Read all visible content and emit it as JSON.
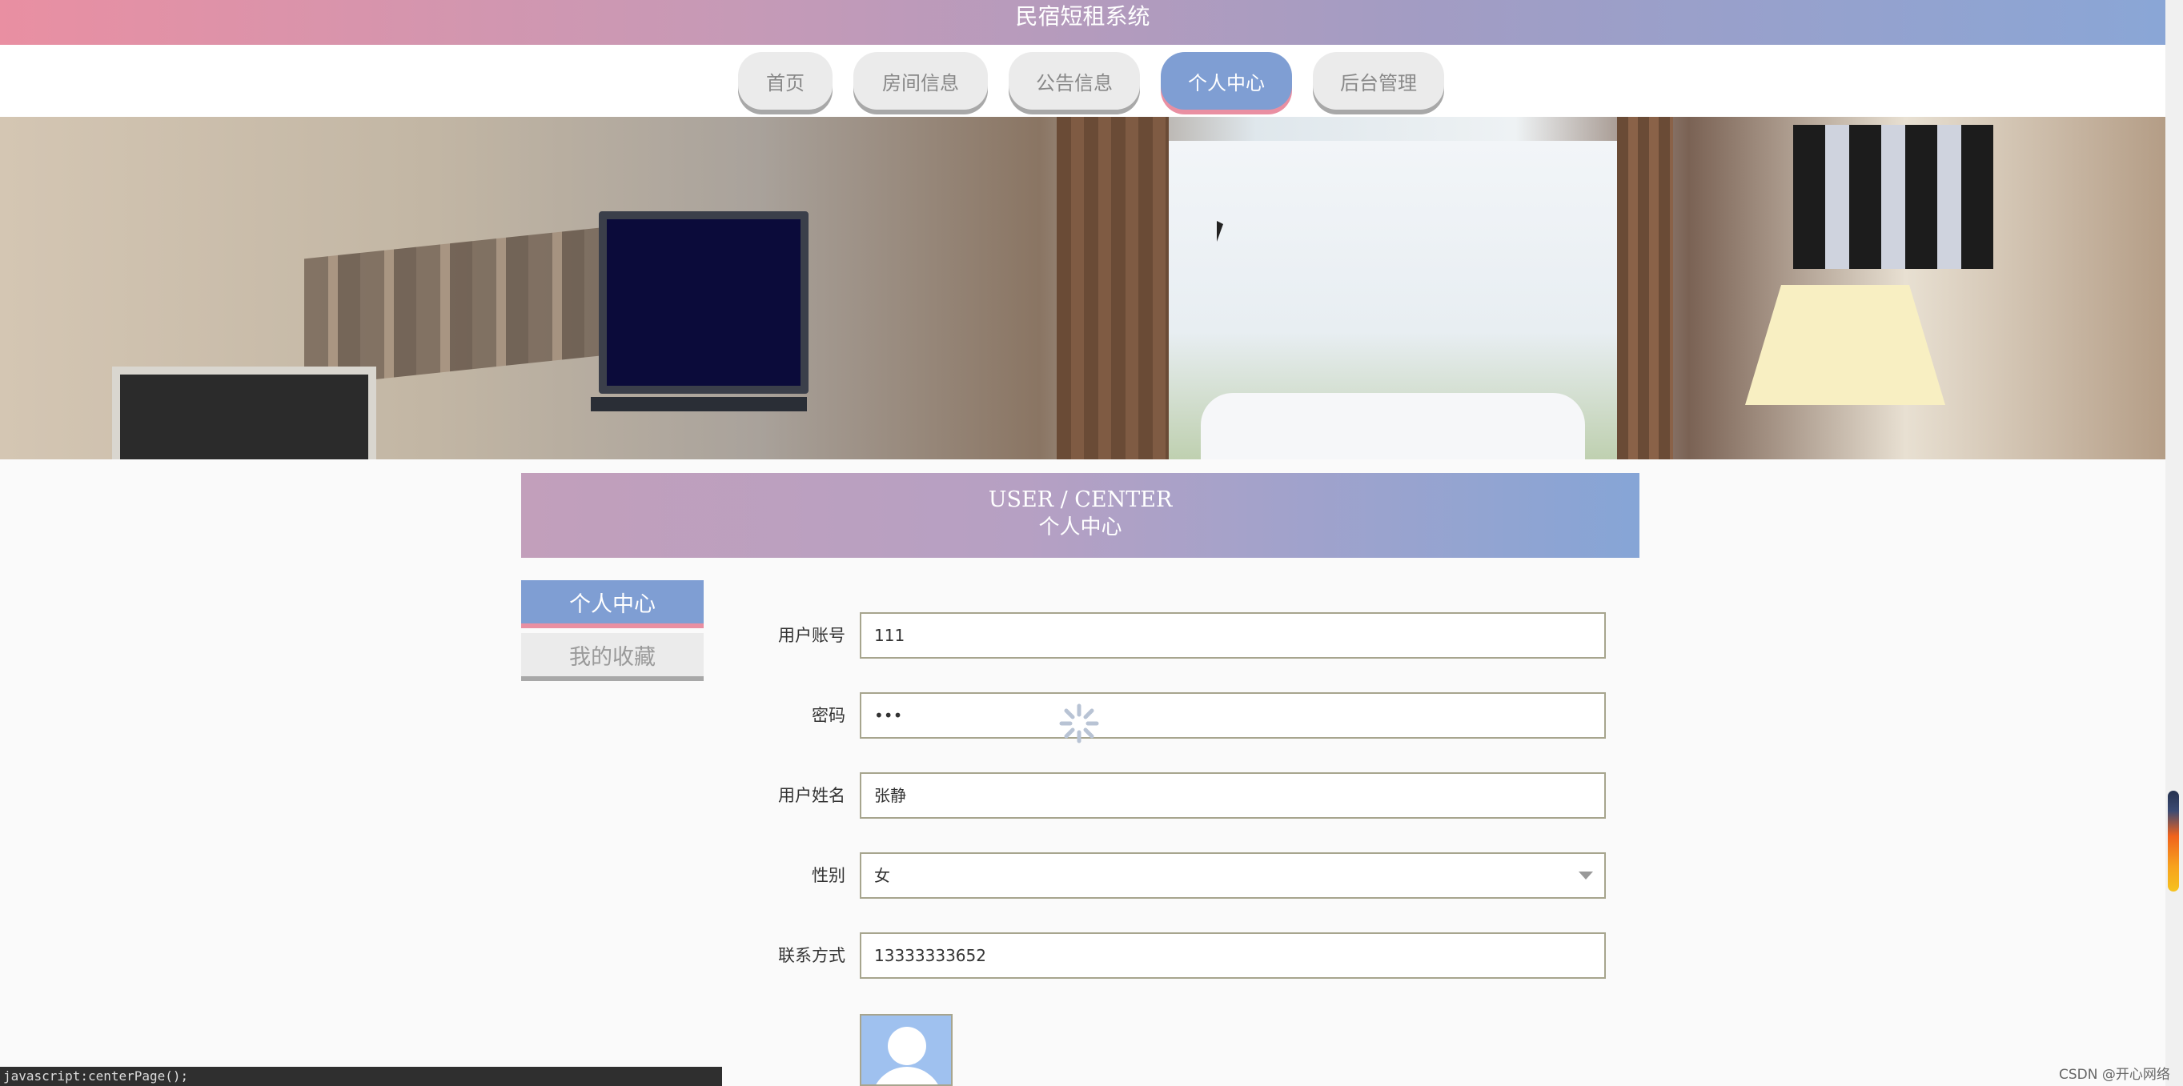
{
  "header": {
    "title": "民宿短租系统"
  },
  "nav": {
    "items": [
      {
        "label": "首页"
      },
      {
        "label": "房间信息"
      },
      {
        "label": "公告信息"
      },
      {
        "label": "个人中心",
        "active": true
      },
      {
        "label": "后台管理"
      }
    ]
  },
  "section": {
    "title_en": "USER / CENTER",
    "title_cn": "个人中心"
  },
  "sidebar": {
    "items": [
      {
        "label": "个人中心",
        "active": true
      },
      {
        "label": "我的收藏"
      }
    ]
  },
  "form": {
    "account": {
      "label": "用户账号",
      "value": "111"
    },
    "password": {
      "label": "密码",
      "value": "•••"
    },
    "name": {
      "label": "用户姓名",
      "value": "张静"
    },
    "gender": {
      "label": "性别",
      "value": "女"
    },
    "phone": {
      "label": "联系方式",
      "value": "13333333652"
    }
  },
  "status_bar": {
    "text": "javascript:centerPage();"
  },
  "watermark": "CSDN @开心网络",
  "colors": {
    "accent_blue": "#7f9ed3",
    "accent_pink": "#e98fa2"
  },
  "icons": {
    "avatar": "user-avatar-placeholder-icon",
    "loading": "loading-spinner-icon",
    "select": "chevron-down-icon"
  }
}
